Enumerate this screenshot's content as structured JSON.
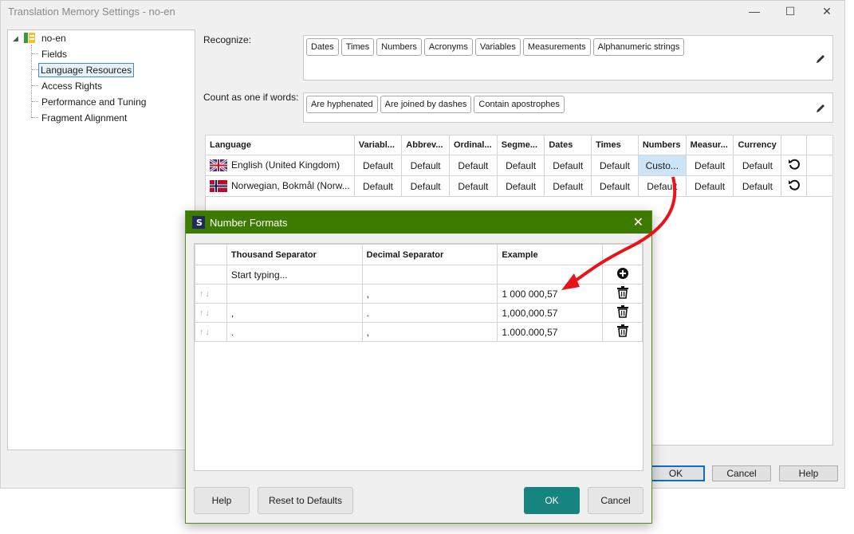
{
  "window": {
    "title": "Translation Memory Settings - no-en"
  },
  "tree": {
    "root": "no-en",
    "items": [
      "Fields",
      "Language Resources",
      "Access Rights",
      "Performance and Tuning",
      "Fragment Alignment"
    ],
    "selected": "Language Resources"
  },
  "recognize": {
    "label": "Recognize:",
    "tags": [
      "Dates",
      "Times",
      "Numbers",
      "Acronyms",
      "Variables",
      "Measurements",
      "Alphanumeric strings"
    ]
  },
  "count_words": {
    "label": "Count as one if words:",
    "tags": [
      "Are hyphenated",
      "Are joined by dashes",
      "Contain apostrophes"
    ]
  },
  "languages_table": {
    "headers": [
      "Language",
      "Variabl...",
      "Abbrev...",
      "Ordinal...",
      "Segme...",
      "Dates",
      "Times",
      "Numbers",
      "Measur...",
      "Currency"
    ],
    "rows": [
      {
        "language": "English (United Kingdom)",
        "cells": [
          "Default",
          "Default",
          "Default",
          "Default",
          "Default",
          "Default",
          "Custo...",
          "Default",
          "Default"
        ]
      },
      {
        "language": "Norwegian, Bokmål (Norw...",
        "cells": [
          "Default",
          "Default",
          "Default",
          "Default",
          "Default",
          "Default",
          "Default",
          "Default",
          "Default"
        ]
      }
    ]
  },
  "main_buttons": {
    "ok": "OK",
    "cancel": "Cancel",
    "help": "Help"
  },
  "dialog": {
    "title": "Number Formats",
    "headers": [
      "Thousand Separator",
      "Decimal Separator",
      "Example"
    ],
    "new_row_placeholder": "Start typing...",
    "rows": [
      {
        "thousand": " ",
        "decimal": ",",
        "example": "1 000 000,57"
      },
      {
        "thousand": ",",
        "decimal": ".",
        "example": "1,000,000.57"
      },
      {
        "thousand": ".",
        "decimal": ",",
        "example": "1.000.000,57"
      }
    ],
    "buttons": {
      "help": "Help",
      "reset": "Reset to Defaults",
      "ok": "OK",
      "cancel": "Cancel"
    }
  },
  "colors": {
    "dialog_title": "#3d7a00",
    "ok_button": "#17857f",
    "arrow": "#e8141b",
    "selection": "#cce4f7"
  }
}
